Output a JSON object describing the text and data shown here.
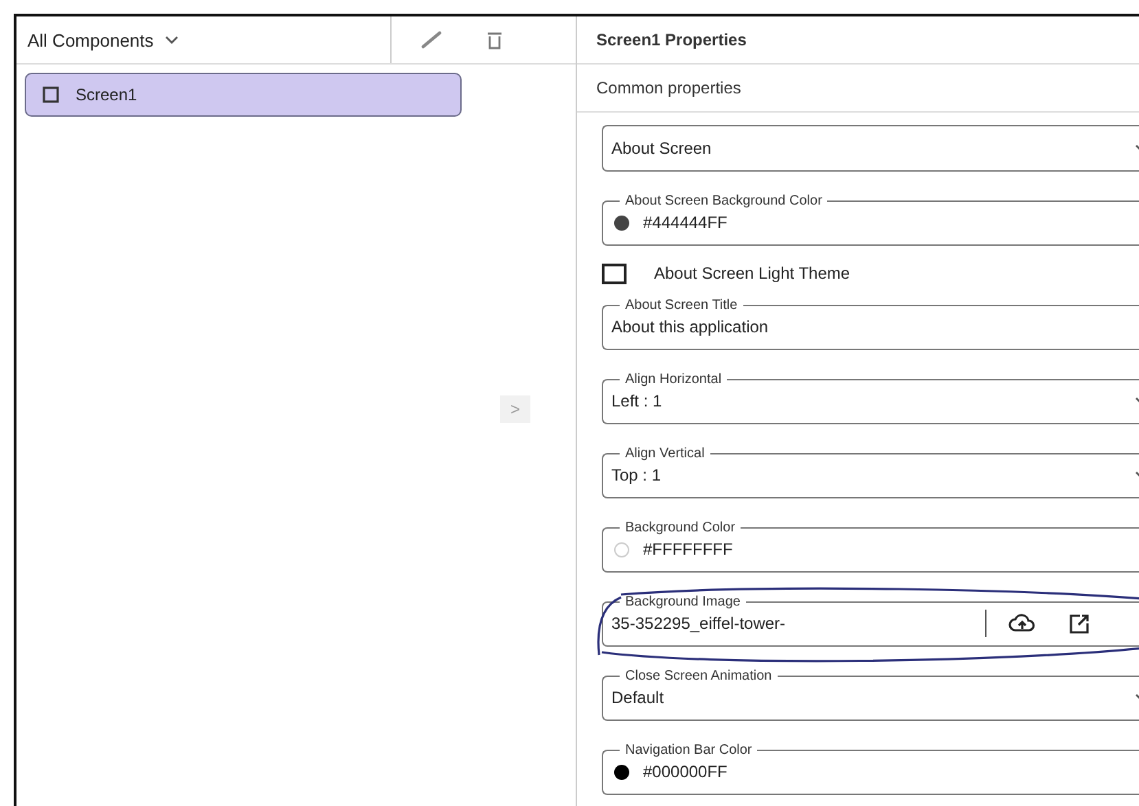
{
  "sidebar": {
    "filter": {
      "label": "All Components"
    },
    "items": [
      {
        "label": "Screen1",
        "selected": true
      }
    ]
  },
  "collapse_button": {
    "label": ">"
  },
  "properties": {
    "title": "Screen1 Properties",
    "section": "Common properties",
    "fields": [
      {
        "kind": "select",
        "value": "About Screen"
      },
      {
        "kind": "color",
        "label": "About Screen Background Color",
        "value": "#444444FF",
        "color": "#444444"
      },
      {
        "kind": "checkbox",
        "label": "About Screen Light Theme",
        "checked": false
      },
      {
        "kind": "text",
        "label": "About Screen Title",
        "value": "About this application"
      },
      {
        "kind": "select",
        "label": "Align Horizontal",
        "value": "Left : 1"
      },
      {
        "kind": "select",
        "label": "Align Vertical",
        "value": "Top : 1"
      },
      {
        "kind": "color",
        "label": "Background Color",
        "value": "#FFFFFFFF",
        "color": "#ffffff"
      },
      {
        "kind": "asset",
        "label": "Background Image",
        "value": "35-352295_eiffel-tower-",
        "annotated": true
      },
      {
        "kind": "select",
        "label": "Close Screen Animation",
        "value": "Default"
      },
      {
        "kind": "color",
        "label": "Navigation Bar Color",
        "value": "#000000FF",
        "color": "#000000"
      }
    ]
  }
}
